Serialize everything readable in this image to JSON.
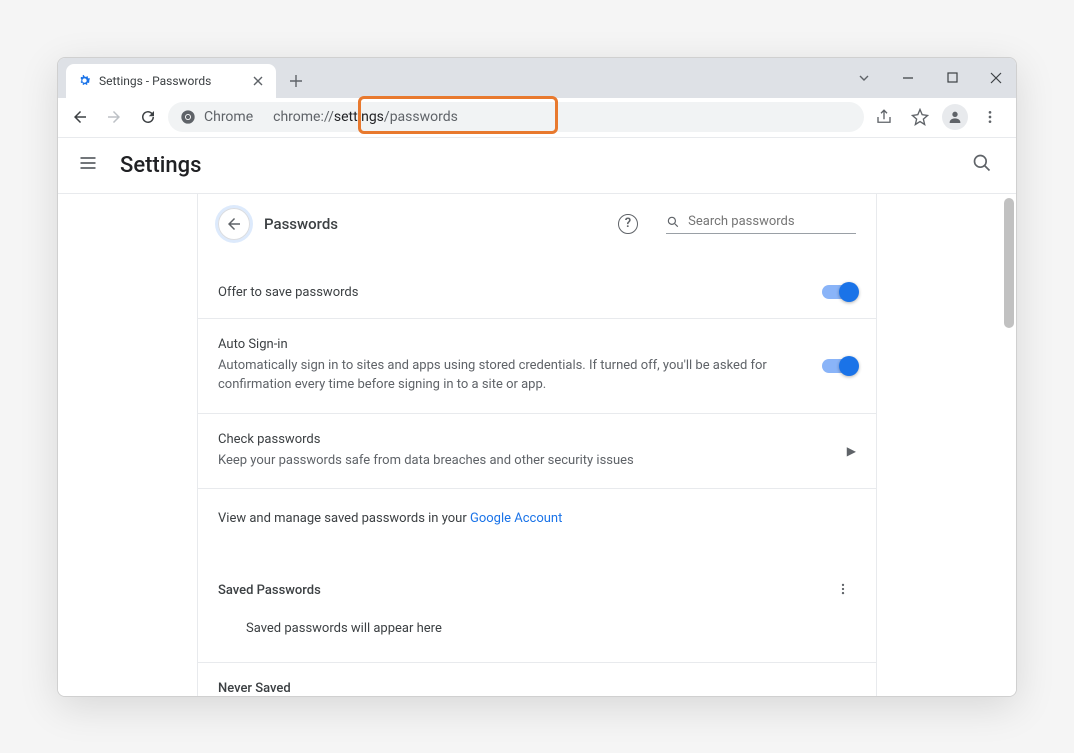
{
  "tab": {
    "title": "Settings - Passwords"
  },
  "omnibox": {
    "prefix_label": "Chrome",
    "url_scheme": "chrome://",
    "url_bold": "settings",
    "url_path": "/passwords"
  },
  "header": {
    "title": "Settings"
  },
  "section": {
    "title": "Passwords",
    "search_placeholder": "Search passwords"
  },
  "rows": {
    "offer_save": {
      "title": "Offer to save passwords"
    },
    "auto_signin": {
      "title": "Auto Sign-in",
      "sub": "Automatically sign in to sites and apps using stored credentials. If turned off, you'll be asked for confirmation every time before signing in to a site or app."
    },
    "check_passwords": {
      "title": "Check passwords",
      "sub": "Keep your passwords safe from data breaches and other security issues"
    },
    "google_account": {
      "prefix": "View and manage saved passwords in your ",
      "link": "Google Account"
    }
  },
  "saved": {
    "heading": "Saved Passwords",
    "empty": "Saved passwords will appear here"
  },
  "never_saved": {
    "heading": "Never Saved"
  }
}
